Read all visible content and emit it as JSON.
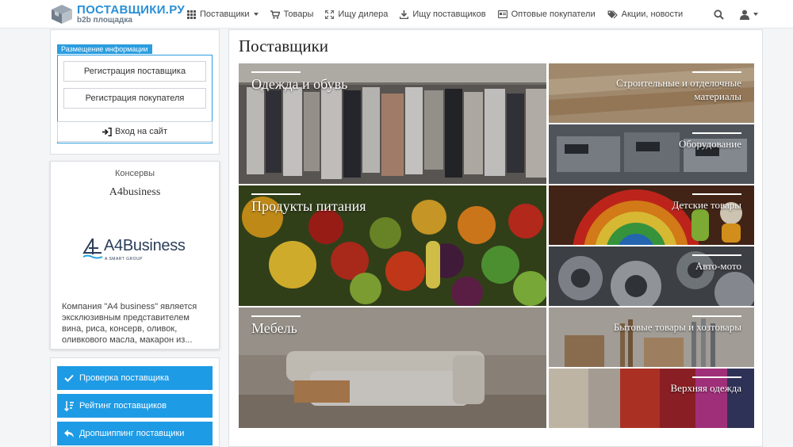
{
  "logo": {
    "title": "ПОСТАВЩИКИ.РУ",
    "subtitle": "b2b площадка"
  },
  "nav": {
    "items": [
      {
        "label": "Поставщики",
        "icon": "grid-icon",
        "dropdown": true
      },
      {
        "label": "Товары",
        "icon": "cart-icon"
      },
      {
        "label": "Ищу дилера",
        "icon": "expand-icon"
      },
      {
        "label": "Ищу поставщиков",
        "icon": "download-icon"
      },
      {
        "label": "Оптовые покупатели",
        "icon": "card-icon"
      },
      {
        "label": "Акции, новости",
        "icon": "tags-icon"
      }
    ]
  },
  "sidebar": {
    "legend": "Размещение информации",
    "register_supplier": "Регистрация поставщика",
    "register_buyer": "Регистрация покупателя",
    "login": "Вход на сайт",
    "company": {
      "category": "Консервы",
      "name": "A4business",
      "logo_text": "A4Business",
      "logo_sub": "A SMART GROUP",
      "description": "Компания \"А4 business\" является эксклюзивным представителем вина, риса, консерв, оливок, оливкового масла, макарон из..."
    },
    "actions": [
      {
        "label": "Проверка поставщика",
        "icon": "check-icon"
      },
      {
        "label": "Рейтинг поставщиков",
        "icon": "sort-icon"
      },
      {
        "label": "Дропшиппинг поставщики",
        "icon": "reply-icon"
      }
    ]
  },
  "main": {
    "title": "Поставщики",
    "tiles_big": [
      "Одежда и обувь",
      "Продукты питания",
      "Мебель"
    ],
    "tiles_small": [
      "Строительные и отделочные материалы",
      "Оборудование",
      "Детские товары",
      "Авто-мото",
      "Бытовые товары и хозтовары",
      "Верхняя одежда"
    ]
  },
  "colors": {
    "accent": "#1e9be5",
    "brand": "#2a8fd6"
  }
}
